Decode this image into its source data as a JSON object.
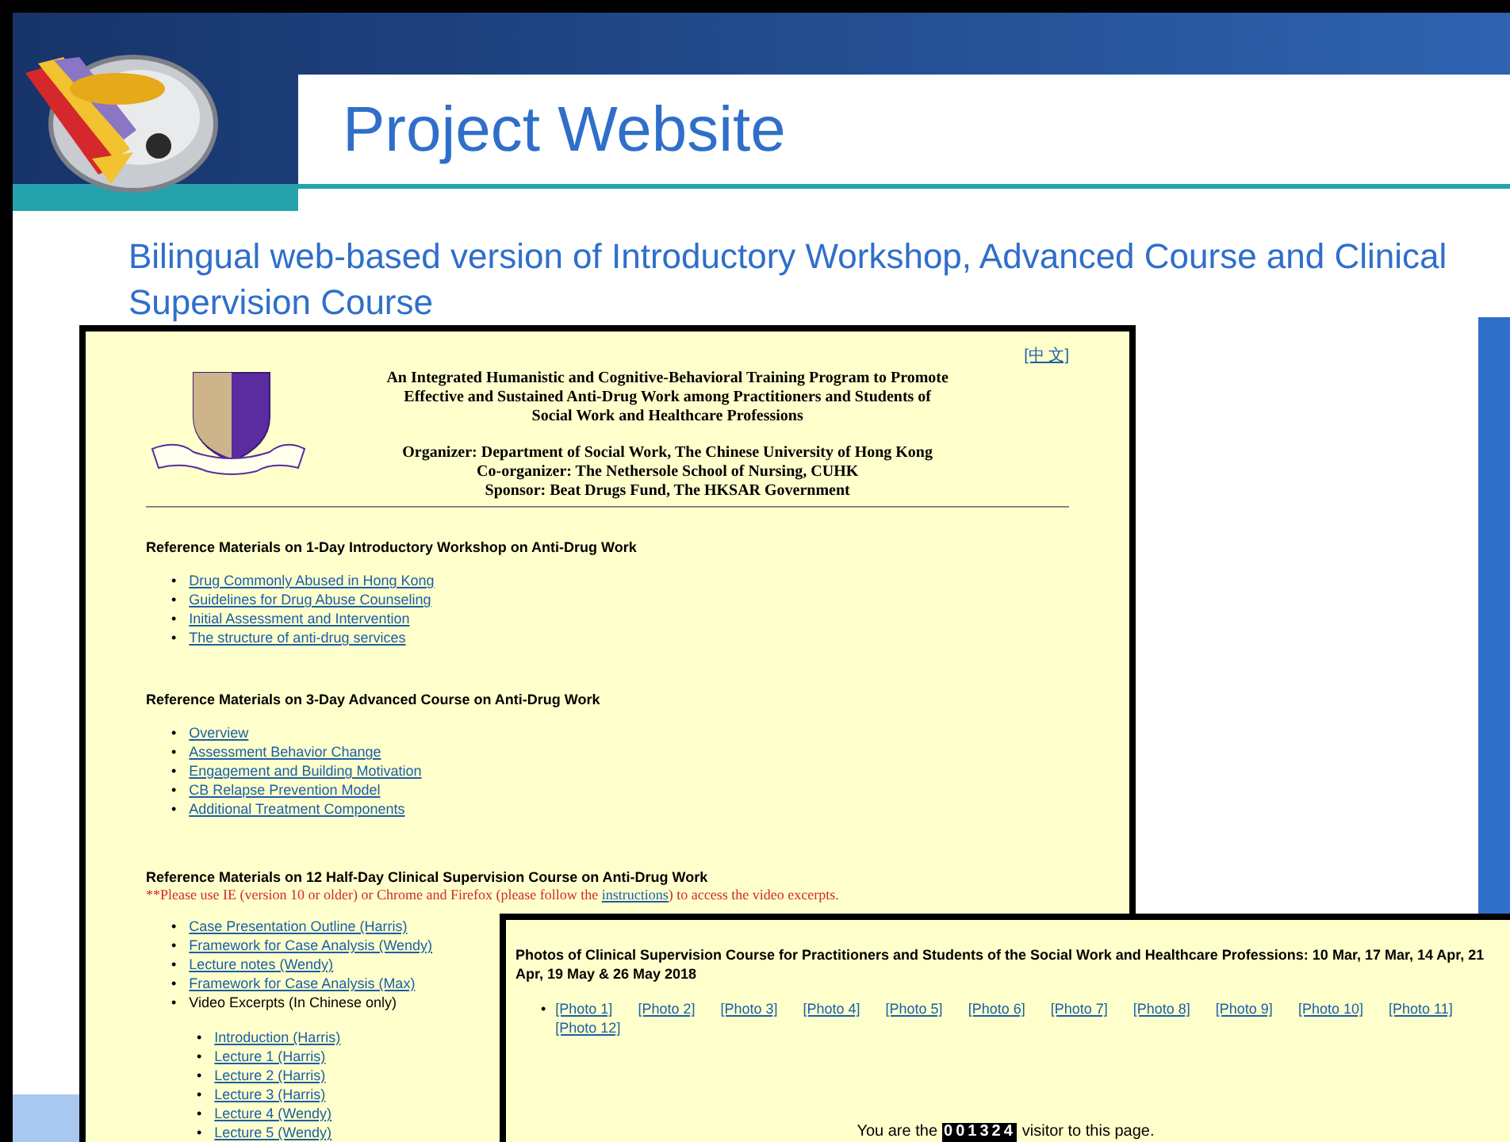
{
  "slide": {
    "title": "Project Website",
    "subtitle": "Bilingual web-based version of Introductory Workshop, Advanced Course and Clinical Supervision Course"
  },
  "website": {
    "language_link": "[中 文]",
    "bullet": "•",
    "heading_lines": [
      "An Integrated Humanistic and Cognitive-Behavioral Training Program to Promote",
      "Effective and Sustained Anti-Drug Work among Practitioners and Students of",
      "Social Work and Healthcare Professions"
    ],
    "credits": [
      "Organizer: Department of Social Work, The Chinese University of Hong Kong",
      "Co-organizer: The Nethersole School of Nursing, CUHK",
      "Sponsor: Beat Drugs Fund, The HKSAR Government"
    ],
    "sections": [
      {
        "title": "Reference Materials on 1-Day Introductory Workshop on Anti-Drug Work",
        "items": [
          {
            "kind": "link",
            "text": "Drug Commonly Abused in Hong Kong"
          },
          {
            "kind": "link",
            "text": "Guidelines for Drug Abuse Counseling"
          },
          {
            "kind": "link",
            "text": "Initial Assessment and Intervention"
          },
          {
            "kind": "link",
            "text": "The structure of anti-drug services"
          }
        ]
      },
      {
        "title": "Reference Materials on 3-Day Advanced Course on Anti-Drug Work",
        "items": [
          {
            "kind": "link",
            "text": "Overview"
          },
          {
            "kind": "link",
            "text": "Assessment Behavior Change"
          },
          {
            "kind": "link",
            "text": "Engagement and Building Motivation"
          },
          {
            "kind": "link",
            "text": "CB Relapse Prevention Model"
          },
          {
            "kind": "link",
            "text": "Additional Treatment Components"
          }
        ]
      },
      {
        "title": "Reference Materials on 12 Half-Day Clinical Supervision Course on Anti-Drug Work",
        "note": {
          "before": "**Please use IE (version 10 or older) or Chrome and Firefox (please follow the ",
          "link": "instructions",
          "after": ") to access the video excerpts."
        },
        "items": [
          {
            "kind": "link",
            "text": "Case Presentation Outline (Harris)"
          },
          {
            "kind": "link",
            "text": "Framework for Case Analysis (Wendy)"
          },
          {
            "kind": "link",
            "text": "Lecture notes (Wendy)"
          },
          {
            "kind": "link",
            "text": "Framework for Case Analysis (Max)"
          },
          {
            "kind": "text",
            "text": "Video Excerpts (In Chinese only)",
            "children": [
              {
                "kind": "link",
                "text": "Introduction (Harris)"
              },
              {
                "kind": "link",
                "text": "Lecture 1 (Harris)"
              },
              {
                "kind": "link",
                "text": "Lecture 2 (Harris)"
              },
              {
                "kind": "link",
                "text": "Lecture 3 (Harris)"
              },
              {
                "kind": "link",
                "text": "Lecture 4 (Wendy)"
              },
              {
                "kind": "link",
                "text": "Lecture 5 (Wendy)"
              }
            ]
          }
        ]
      }
    ]
  },
  "photos_page": {
    "title": "Photos of Clinical Supervision Course for Practitioners and Students of the Social Work and Healthcare Professions: 10 Mar, 17 Mar, 14 Apr, 21 Apr, 19 May & 26 May 2018",
    "bullet": "•",
    "photo_links": [
      "[Photo 1]",
      "[Photo 2]",
      "[Photo 3]",
      "[Photo 4]",
      "[Photo 5]",
      "[Photo 6]",
      "[Photo 7]",
      "[Photo 8]",
      "[Photo 9]",
      "[Photo 10]",
      "[Photo 11]",
      "[Photo 12]"
    ],
    "counter": {
      "before": "You are the",
      "digits": "001324",
      "after": "visitor to this page."
    }
  }
}
